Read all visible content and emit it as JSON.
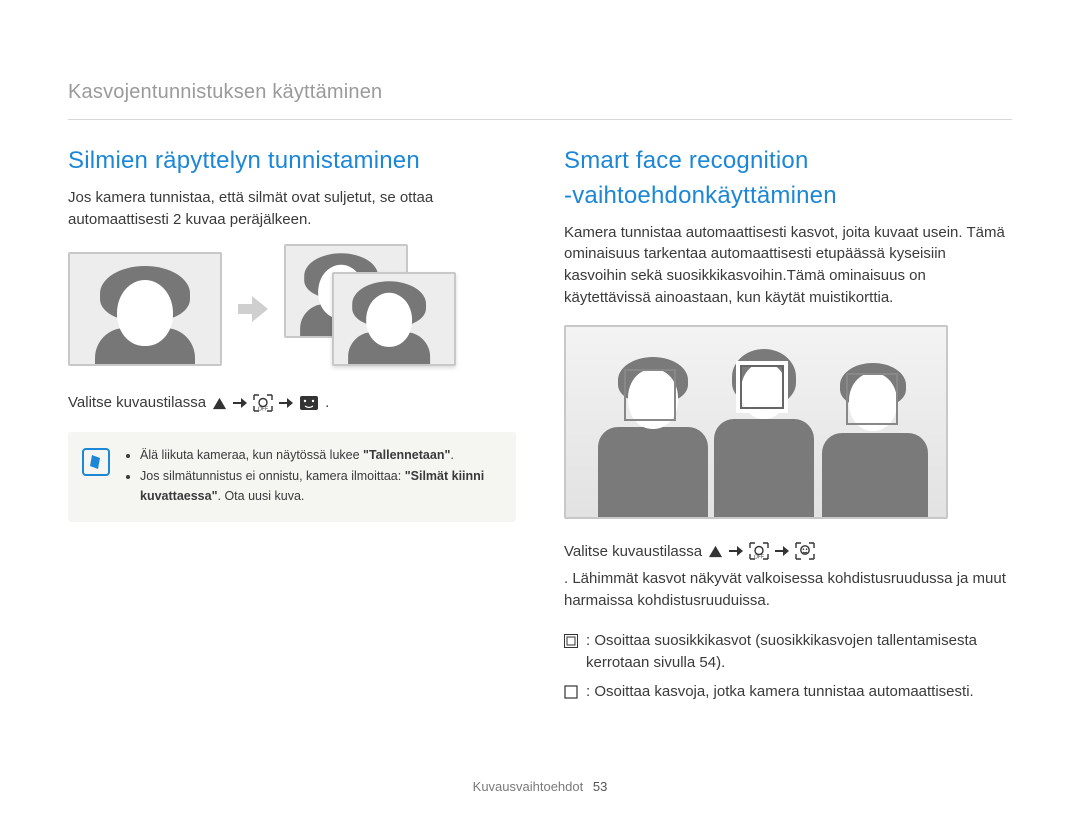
{
  "breadcrumb": "Kasvojentunnistuksen käyttäminen",
  "left": {
    "heading": "Silmien räpyttelyn tunnistaminen",
    "paragraph": "Jos kamera tunnistaa, että silmät ovat suljetut, se ottaa automaattisesti 2 kuvaa peräjälkeen.",
    "instruction_prefix": "Valitse kuvaustilassa",
    "note_items": [
      {
        "pre": "Älä liikuta kameraa, kun näytössä lukee ",
        "quote": "\"Tallennetaan\"",
        "post": "."
      },
      {
        "pre": "Jos silmätunnistus ei onnistu, kamera ilmoittaa: ",
        "quote": "\"Silmät kiinni kuvattaessa\"",
        "post": ". Ota uusi kuva."
      }
    ]
  },
  "right": {
    "heading_line1": "Smart face recognition",
    "heading_line2": "-vaihtoehdonkäyttäminen",
    "paragraph": "Kamera tunnistaa automaattisesti kasvot, joita kuvaat usein. Tämä ominaisuus tarkentaa automaattisesti etupäässä kyseisiin kasvoihin sekä suosikkikasvoihin.Tämä ominaisuus on käytettävissä ainoastaan, kun käytät muistikorttia.",
    "instruction_prefix": "Valitse kuvaustilassa",
    "instruction_suffix": ". Lähimmät kasvot näkyvät valkoisessa kohdistusruudussa ja muut harmaissa kohdistusruuduissa.",
    "bullets": [
      ": Osoittaa suosikkikasvot (suosikkikasvojen tallentamisesta kerrotaan sivulla 54).",
      ": Osoittaa kasvoja, jotka kamera tunnistaa automaattisesti."
    ]
  },
  "footer": {
    "section": "Kuvausvaihtoehdot",
    "page": "53"
  }
}
